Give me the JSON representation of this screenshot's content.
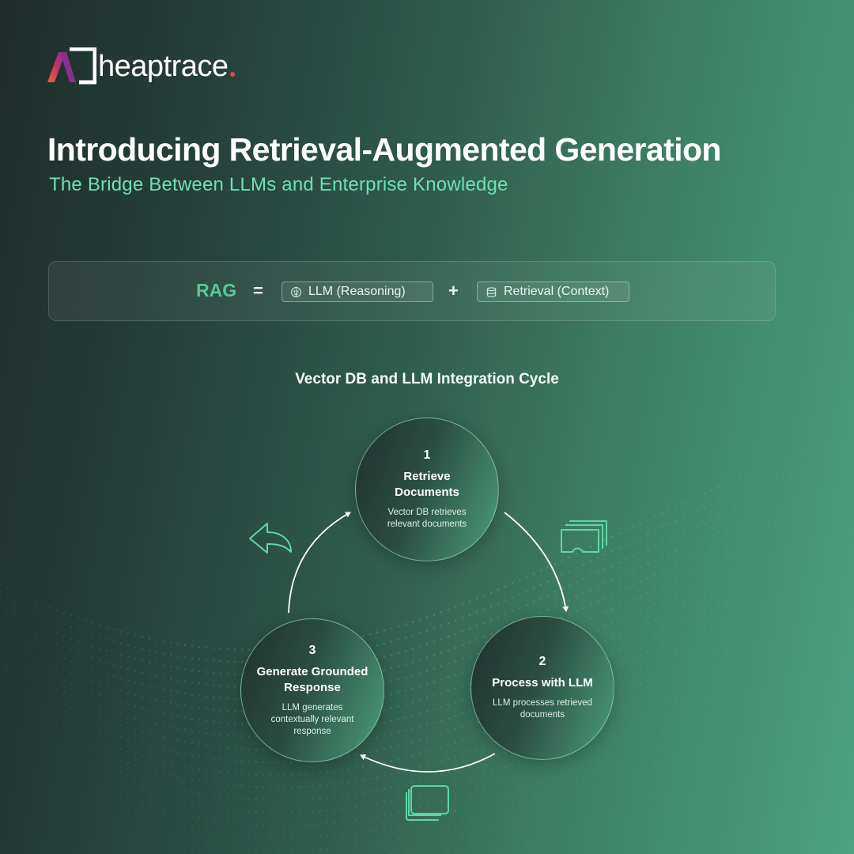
{
  "brand": {
    "name": "heaptrace"
  },
  "header": {
    "title": "Introducing Retrieval-Augmented Generation",
    "subtitle": "The Bridge Between LLMs and Enterprise Knowledge"
  },
  "equation": {
    "lhs": "RAG",
    "equals": "=",
    "plus": "+",
    "term1": {
      "label": "LLM (Reasoning)",
      "icon": "brain-icon"
    },
    "term2": {
      "label": "Retrieval (Context)",
      "icon": "database-icon"
    }
  },
  "cycle": {
    "title": "Vector DB and LLM Integration Cycle",
    "steps": [
      {
        "number": "1",
        "title": "Retrieve Documents",
        "description": "Vector DB retrieves relevant documents"
      },
      {
        "number": "2",
        "title": "Process with LLM",
        "description": "LLM processes retrieved documents"
      },
      {
        "number": "3",
        "title": "Generate Grounded Response",
        "description": "LLM generates contextually relevant response"
      }
    ],
    "icons": [
      "documents-icon",
      "copy-icon",
      "reply-arrow-icon"
    ]
  },
  "colors": {
    "accent": "#6fe0b4",
    "rag_green": "#5ac896",
    "logo_gradient": [
      "#f0603c",
      "#c0306a",
      "#7a2fa8"
    ],
    "logo_dot": "#e5484d"
  }
}
